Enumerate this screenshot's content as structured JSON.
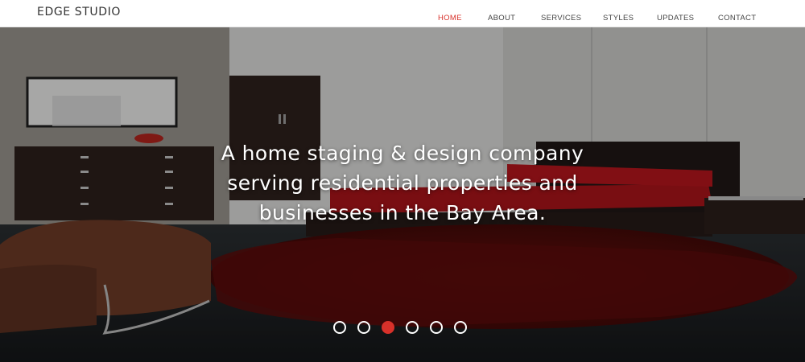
{
  "brand": {
    "name": "EDGE STUDIO"
  },
  "nav": {
    "items": [
      {
        "label": "HOME",
        "active": true
      },
      {
        "label": "ABOUT",
        "active": false
      },
      {
        "label": "SERVICES",
        "active": false
      },
      {
        "label": "STYLES",
        "active": false
      },
      {
        "label": "UPDATES",
        "active": false
      },
      {
        "label": "CONTACT",
        "active": false
      }
    ]
  },
  "hero": {
    "caption_lines": [
      "A home staging & design company",
      "serving residential properties and",
      "businesses in the Bay Area."
    ],
    "slides_total": 6,
    "active_slide": 3
  },
  "colors": {
    "accent": "#d8312a",
    "nav_text": "#444444",
    "brand_text": "#333333"
  }
}
